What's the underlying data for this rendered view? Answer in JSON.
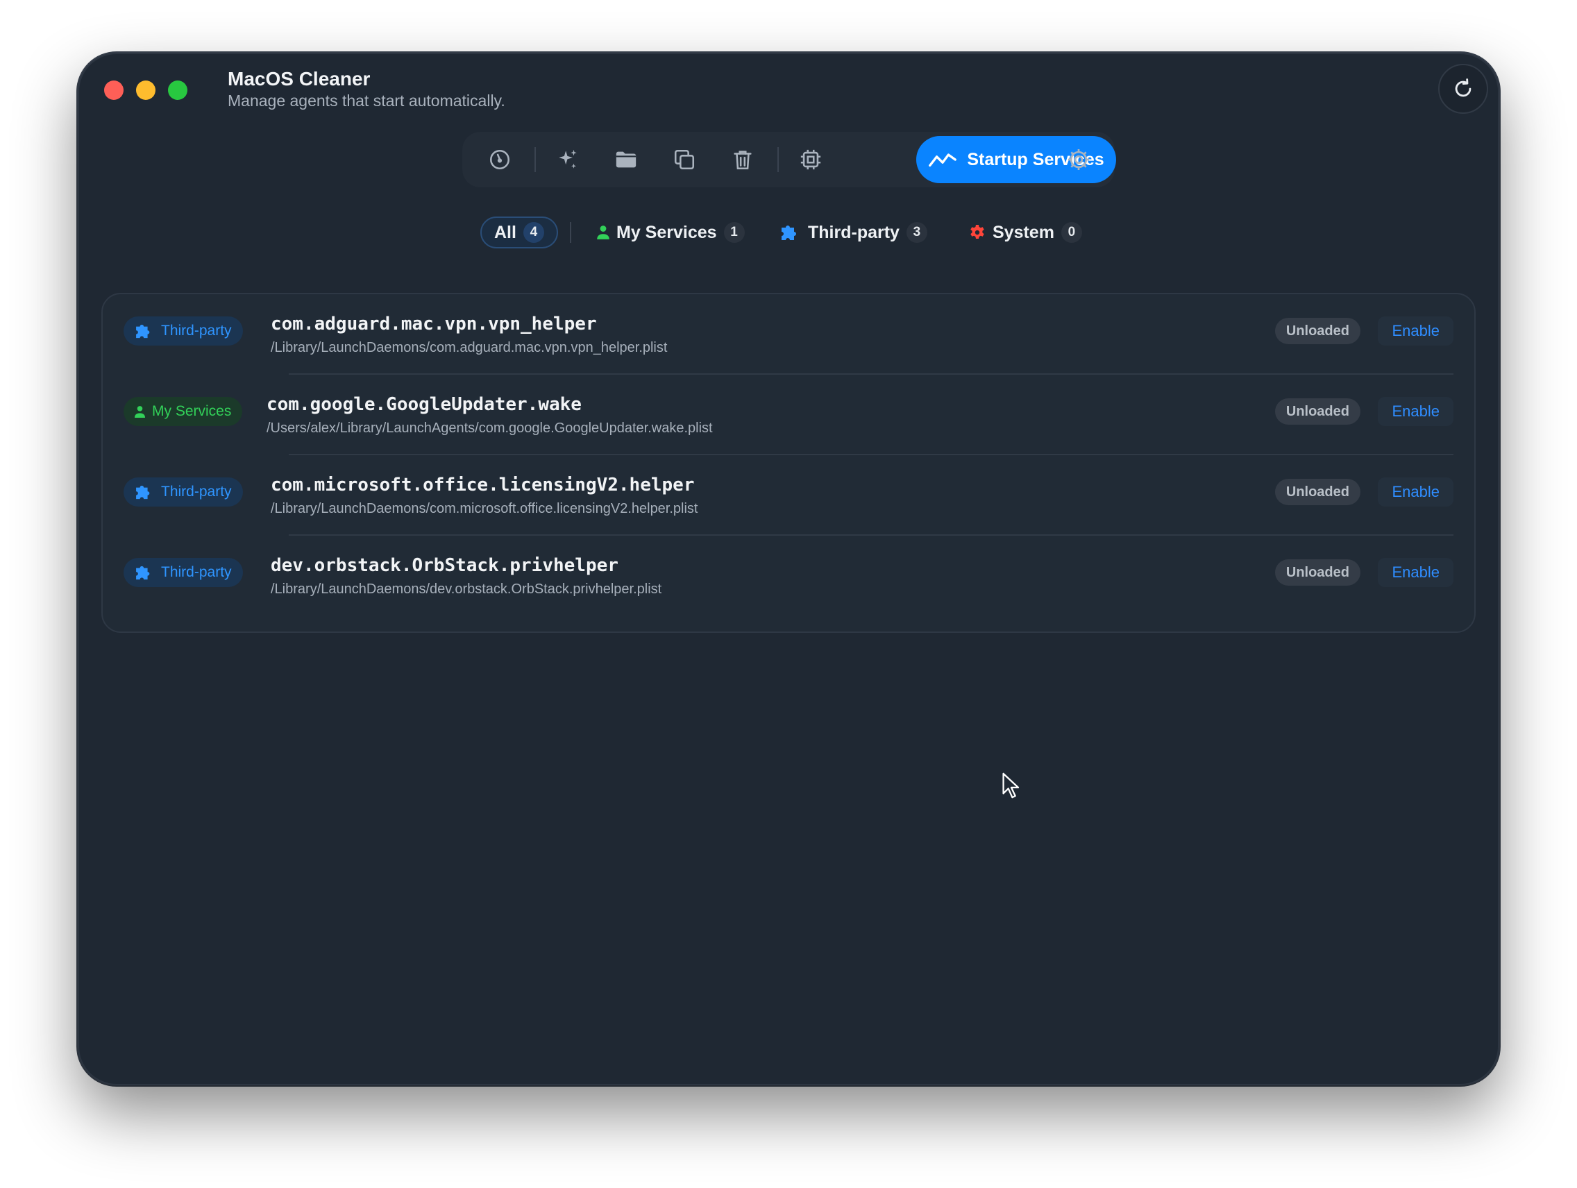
{
  "app": {
    "title": "MacOS Cleaner",
    "subtitle": "Manage agents that start automatically."
  },
  "toolbar": {
    "items": [
      {
        "icon": "gauge-icon"
      },
      {
        "icon": "sparkle-icon"
      },
      {
        "icon": "folder-icon"
      },
      {
        "icon": "duplicate-icon"
      },
      {
        "icon": "trash-icon"
      },
      {
        "icon": "cpu-icon"
      },
      {
        "icon": "startup-chart-icon",
        "label": "Startup Services",
        "active": true
      },
      {
        "icon": "settings-gear-icon"
      }
    ]
  },
  "filters": [
    {
      "label": "All",
      "count": "4",
      "active": true
    },
    {
      "label": "My Services",
      "count": "1",
      "icon": "person-icon"
    },
    {
      "label": "Third-party",
      "count": "3",
      "icon": "puzzle-icon"
    },
    {
      "label": "System",
      "count": "0",
      "icon": "gear-icon"
    }
  ],
  "services": [
    {
      "category": "Third-party",
      "name": "com.adguard.mac.vpn.vpn_helper",
      "path": "/Library/LaunchDaemons/com.adguard.mac.vpn.vpn_helper.plist",
      "status": "Unloaded",
      "action": "Enable"
    },
    {
      "category": "My Services",
      "name": "com.google.GoogleUpdater.wake",
      "path": "/Users/alex/Library/LaunchAgents/com.google.GoogleUpdater.wake.plist",
      "status": "Unloaded",
      "action": "Enable"
    },
    {
      "category": "Third-party",
      "name": "com.microsoft.office.licensingV2.helper",
      "path": "/Library/LaunchDaemons/com.microsoft.office.licensingV2.helper.plist",
      "status": "Unloaded",
      "action": "Enable"
    },
    {
      "category": "Third-party",
      "name": "dev.orbstack.OrbStack.privhelper",
      "path": "/Library/LaunchDaemons/dev.orbstack.OrbStack.privhelper.plist",
      "status": "Unloaded",
      "action": "Enable"
    }
  ],
  "colors": {
    "accent": "#0a84ff",
    "third_party": "#2f95ff",
    "my_services": "#32d159",
    "system": "#ff453a",
    "window_bg": "#1f2833"
  }
}
